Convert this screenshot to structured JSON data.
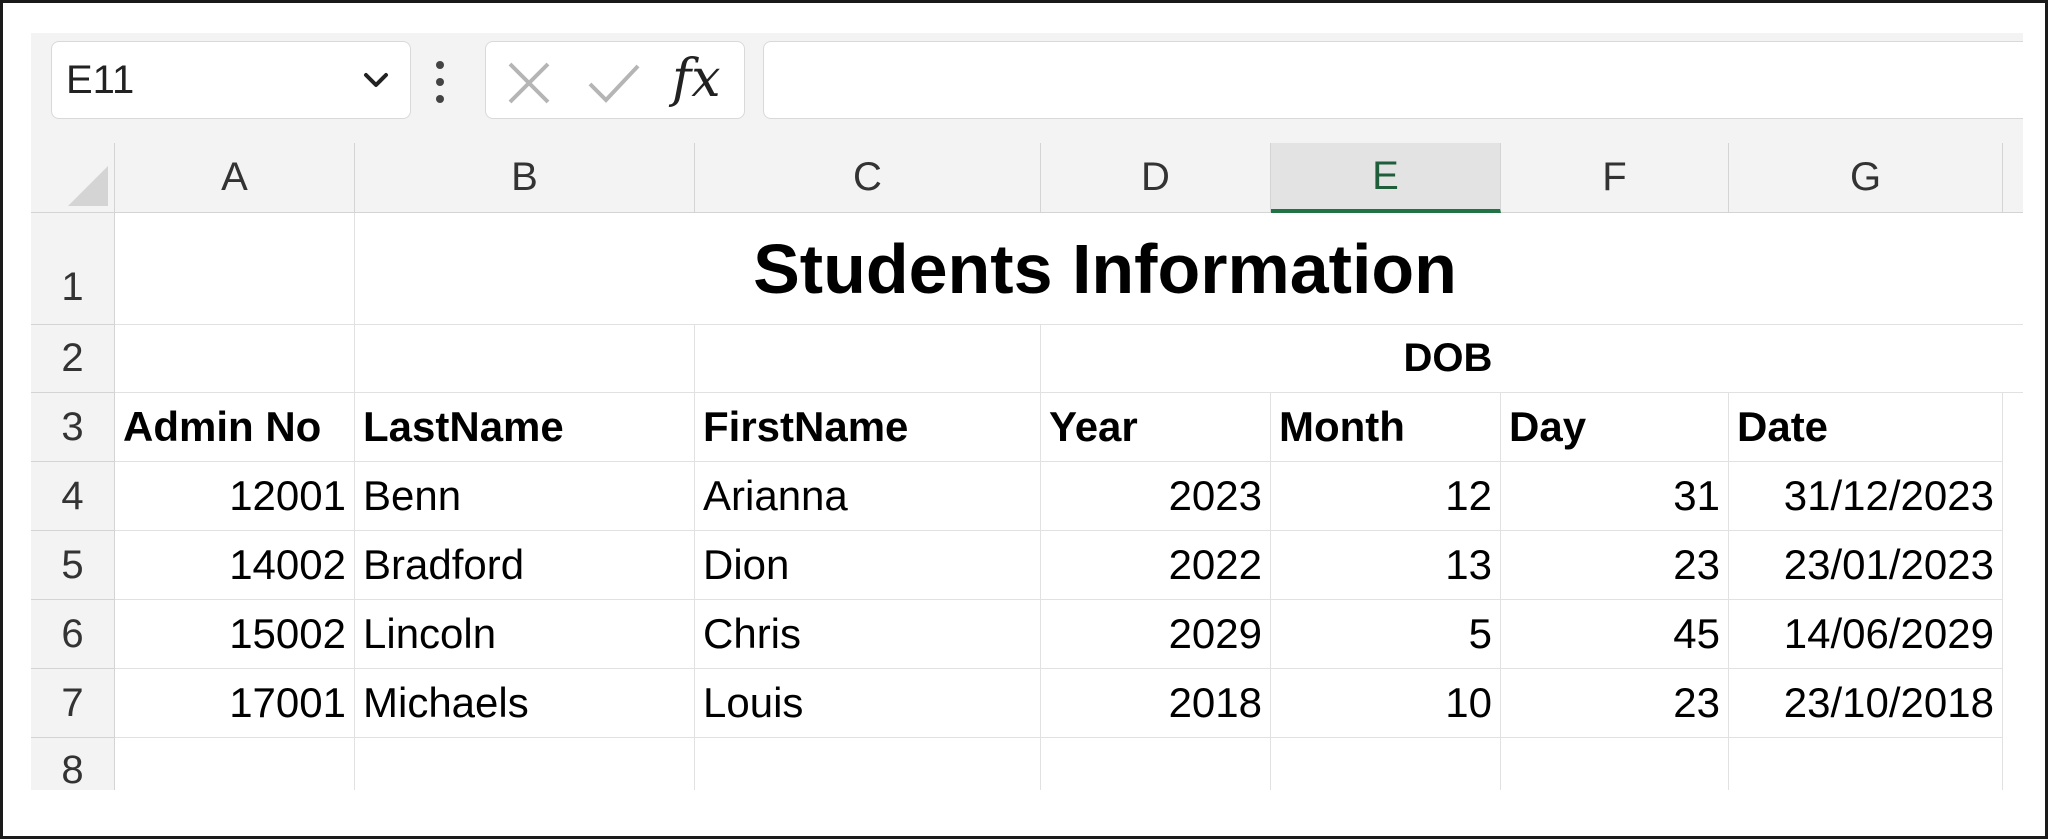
{
  "name_box": {
    "value": "E11"
  },
  "formula_bar": {
    "value": "",
    "insert_function_label": "fx"
  },
  "columns": [
    {
      "letter": "A"
    },
    {
      "letter": "B"
    },
    {
      "letter": "C"
    },
    {
      "letter": "D"
    },
    {
      "letter": "E"
    },
    {
      "letter": "F"
    },
    {
      "letter": "G"
    }
  ],
  "selected_column": "E",
  "rows": [
    "1",
    "2",
    "3",
    "4",
    "5",
    "6",
    "7",
    "8"
  ],
  "sheet": {
    "title": "Students Information",
    "group_header": "DOB",
    "headers": [
      "Admin No",
      "LastName",
      "FirstName",
      "Year",
      "Month",
      "Day",
      "Date"
    ],
    "records": [
      [
        "12001",
        "Benn",
        "Arianna",
        "2023",
        "12",
        "31",
        "31/12/2023"
      ],
      [
        "14002",
        "Bradford",
        "Dion",
        "2022",
        "13",
        "23",
        "23/01/2023"
      ],
      [
        "15002",
        "Lincoln",
        "Chris",
        "2029",
        "5",
        "45",
        "14/06/2029"
      ],
      [
        "17001",
        "Michaels",
        "Louis",
        "2018",
        "10",
        "23",
        "23/10/2018"
      ]
    ]
  }
}
